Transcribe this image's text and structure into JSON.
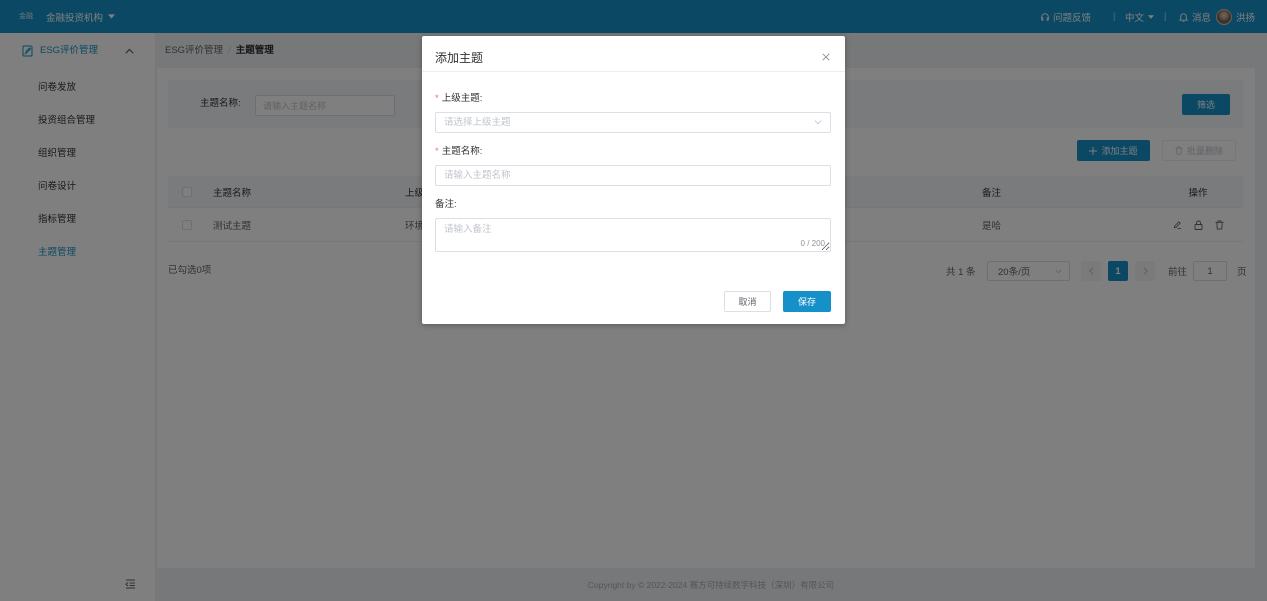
{
  "colors": {
    "primary": "#1690c8",
    "required": "#f56c6c",
    "overlay": "rgba(0,0,0,0.5)",
    "page_bg": "#eef0f3"
  },
  "header": {
    "org_prefix": "金融",
    "org_name": "金融投资机构",
    "org_dropdown_icon": "caret-down-icon",
    "feedback_icon": "headset-icon",
    "feedback_label": "问题反馈",
    "separator": "|",
    "language_label": "中文",
    "messages_icon": "bell-icon",
    "messages_label": "消息",
    "user_name": "洪扬"
  },
  "sidebar": {
    "group_label": "ESG评价管理",
    "group_icon": "document-icon",
    "group_expanded": true,
    "items": [
      {
        "label": "问卷发放",
        "active": false
      },
      {
        "label": "投资组合管理",
        "active": false
      },
      {
        "label": "组织管理",
        "active": false
      },
      {
        "label": "问卷设计",
        "active": false
      },
      {
        "label": "指标管理",
        "active": false
      },
      {
        "label": "主题管理",
        "active": true
      }
    ],
    "collapse_icon": "collapse-icon"
  },
  "breadcrumb": {
    "parent": "ESG评价管理",
    "separator": "/",
    "current": "主题管理"
  },
  "filter": {
    "name_label": "主题名称:",
    "name_placeholder": "请输入主题名称",
    "name_value": "",
    "submit_label": "筛选"
  },
  "toolbar": {
    "add_icon": "plus-icon",
    "add_label": "添加主题",
    "batch_delete_icon": "trash-icon",
    "batch_delete_label": "批量删除",
    "batch_delete_disabled": true
  },
  "table": {
    "columns": [
      "主题名称",
      "上级",
      "备注",
      "操作"
    ],
    "rows": [
      {
        "name": "测试主题",
        "parent": "环境",
        "remark": "是哈",
        "actions": [
          "edit-icon",
          "lock-icon",
          "trash-icon"
        ]
      }
    ],
    "selected_summary": "已勾选0项"
  },
  "pagination": {
    "total": "共 1 条",
    "page_size": "20条/页",
    "current_page": "1",
    "goto_label": "前往",
    "goto_value": "1",
    "goto_suffix": "页"
  },
  "footer": {
    "copyright": "Copyright by © 2022-2024 赛方可持续数字科技（深圳）有限公司"
  },
  "modal": {
    "title": "添加主题",
    "close_icon": "close-icon",
    "required_mark": "*",
    "fields": [
      {
        "label": "上级主题:",
        "required": true,
        "type": "select",
        "placeholder": "请选择上级主题",
        "value": ""
      },
      {
        "label": "主题名称:",
        "required": true,
        "type": "input",
        "placeholder": "请输入主题名称",
        "value": ""
      },
      {
        "label": "备注:",
        "required": false,
        "type": "textarea",
        "placeholder": "请输入备注",
        "value": "",
        "counter": "0 / 200"
      }
    ],
    "cancel_label": "取消",
    "save_label": "保存"
  }
}
